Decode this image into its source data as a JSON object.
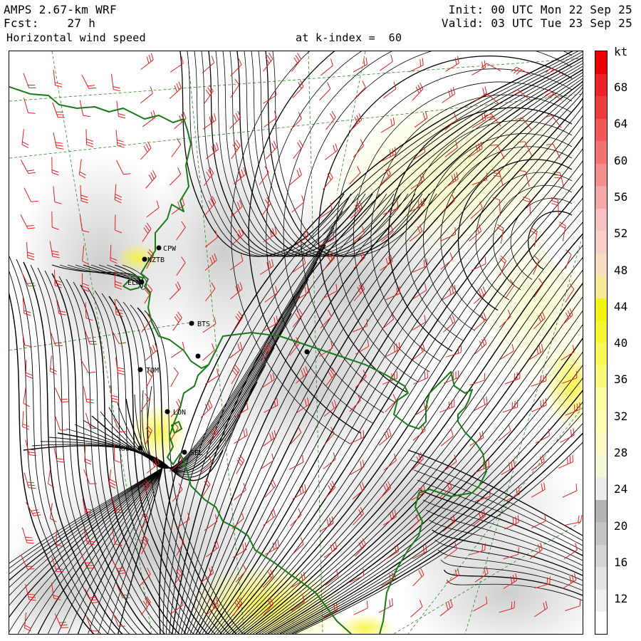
{
  "header": {
    "model": "AMPS 2.67-km WRF",
    "forecast": "Fcst:    27 h",
    "field": "Horizontal wind speed",
    "level": "at k-index =  60",
    "init": "Init: 00 UTC Mon 22 Sep 25",
    "valid": "Valid: 03 UTC Tue 23 Sep 25"
  },
  "colorbar": {
    "unit": "kt",
    "labels": [
      "68",
      "64",
      "60",
      "56",
      "52",
      "48",
      "44",
      "40",
      "36",
      "32",
      "28",
      "24",
      "20",
      "16",
      "12"
    ],
    "colors": [
      "#ffffff",
      "#f0f0f0",
      "#e3e3e3",
      "#d4d4d4",
      "#c4c4c4",
      "#b4b4b4",
      "#ededed",
      "#f6f6d8",
      "#fbfbc6",
      "#fdfdb4",
      "#fcfca0",
      "#fafa7a",
      "#f8f858",
      "#f5f530",
      "#f3f310",
      "#f7e99a",
      "#f9dcc4",
      "#f9cfc9",
      "#f8c2c2",
      "#f6a8a8",
      "#f48f8f",
      "#f27272",
      "#f05757",
      "#ee3d3d",
      "#ec2323",
      "#ea0000"
    ]
  },
  "stations": [
    {
      "id": "CPW",
      "label": "CPW"
    },
    {
      "id": "NZTB",
      "label": "NZTB"
    },
    {
      "id": "ELN",
      "label": "ELN"
    },
    {
      "id": "BTS",
      "label": "BTS"
    },
    {
      "id": "TOM",
      "label": "TOM"
    },
    {
      "id": "LON",
      "label": "LON"
    },
    {
      "id": "KHN",
      "label": "KHN"
    },
    {
      "id": "SEL",
      "label": "SEL"
    }
  ],
  "colors": {
    "coast": "#1a7a1a",
    "barb": "#e02020",
    "grid": "#2a8a2a"
  }
}
